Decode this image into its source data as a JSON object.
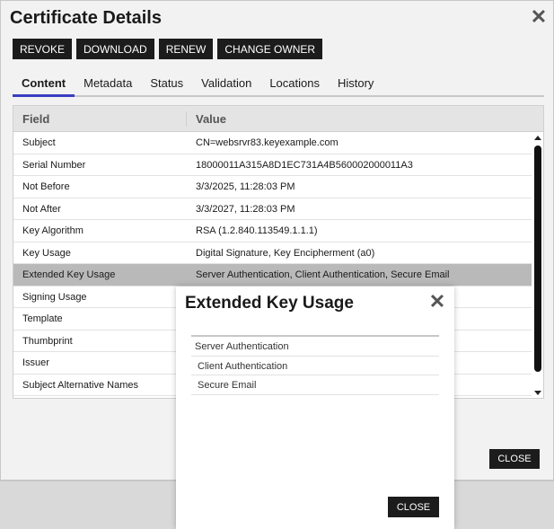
{
  "dialog": {
    "title": "Certificate Details",
    "close_icon": "close-icon",
    "close_label": "CLOSE"
  },
  "toolbar": {
    "revoke_label": "REVOKE",
    "download_label": "DOWNLOAD",
    "renew_label": "RENEW",
    "change_owner_label": "CHANGE OWNER"
  },
  "tabs": [
    {
      "label": "Content",
      "active": true
    },
    {
      "label": "Metadata"
    },
    {
      "label": "Status"
    },
    {
      "label": "Validation"
    },
    {
      "label": "Locations"
    },
    {
      "label": "History"
    }
  ],
  "grid": {
    "columns": [
      "Field",
      "Value"
    ],
    "rows": [
      {
        "field": "Subject",
        "value": "CN=websrvr83.keyexample.com"
      },
      {
        "field": "Serial Number",
        "value": "18000011A315A8D1EC731A4B560002000011A3"
      },
      {
        "field": "Not Before",
        "value": "3/3/2025, 11:28:03 PM"
      },
      {
        "field": "Not After",
        "value": "3/3/2027, 11:28:03 PM"
      },
      {
        "field": "Key Algorithm",
        "value": "RSA (1.2.840.113549.1.1.1)"
      },
      {
        "field": "Key Usage",
        "value": "Digital Signature, Key Encipherment (a0)"
      },
      {
        "field": "Extended Key Usage",
        "value": "Server Authentication, Client Authentication, Secure Email",
        "selected": true
      },
      {
        "field": "Signing Usage",
        "value": ""
      },
      {
        "field": "Template",
        "value": ""
      },
      {
        "field": "Thumbprint",
        "value": ""
      },
      {
        "field": "Issuer",
        "value": ""
      },
      {
        "field": "Subject Alternative Names",
        "value": ""
      }
    ]
  },
  "modal": {
    "title": "Extended Key Usage",
    "items": [
      "Server Authentication",
      "Client Authentication",
      "Secure Email"
    ],
    "close_label": "CLOSE"
  },
  "colors": {
    "active_tab_underline": "#3a3dc0",
    "button_bg": "#1c1c1c",
    "selected_row": "#b9b9b9"
  }
}
